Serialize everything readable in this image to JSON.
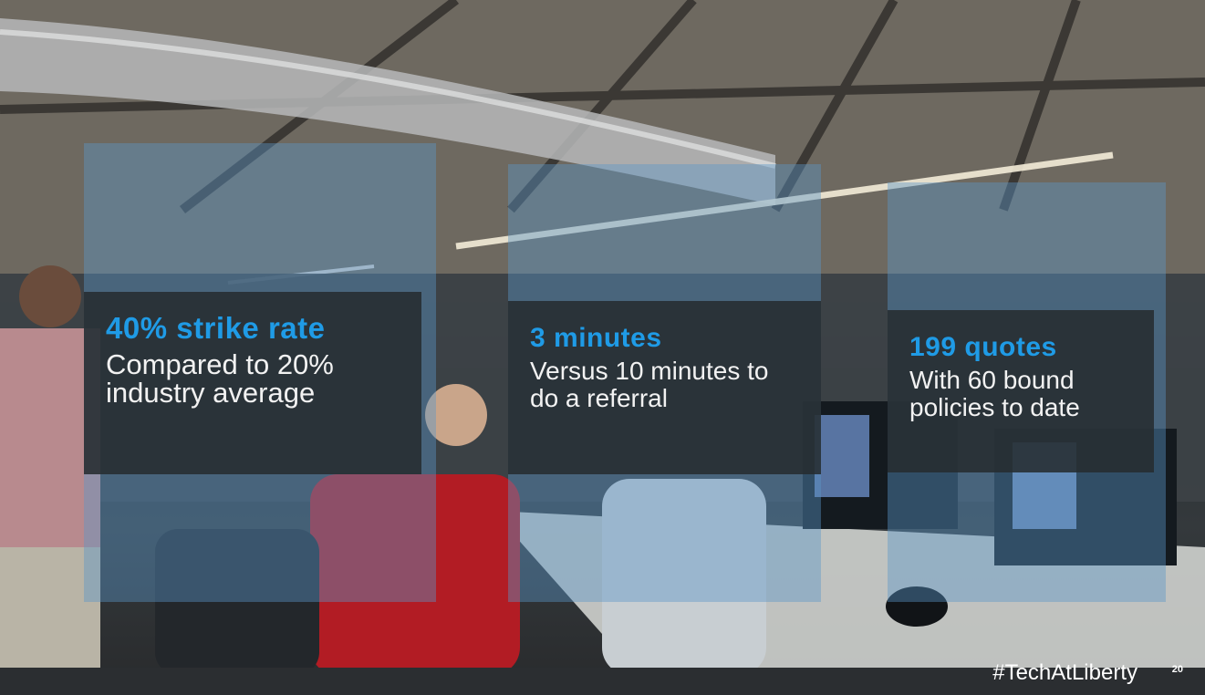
{
  "stats": [
    {
      "headline": "40% strike rate",
      "body": "Compared to 20% industry average"
    },
    {
      "headline": "3 minutes",
      "body": "Versus 10 minutes to do a referral"
    },
    {
      "headline": "199 quotes",
      "body": "With 60 bound policies to date"
    }
  ],
  "footer": {
    "hashtag": "#TechAtLiberty",
    "page_number": "20"
  },
  "colors": {
    "headline": "#1f9be6",
    "panel_blue": "#5a96c8",
    "panel_dark": "#262c30",
    "body_text": "#f2f2f2"
  }
}
